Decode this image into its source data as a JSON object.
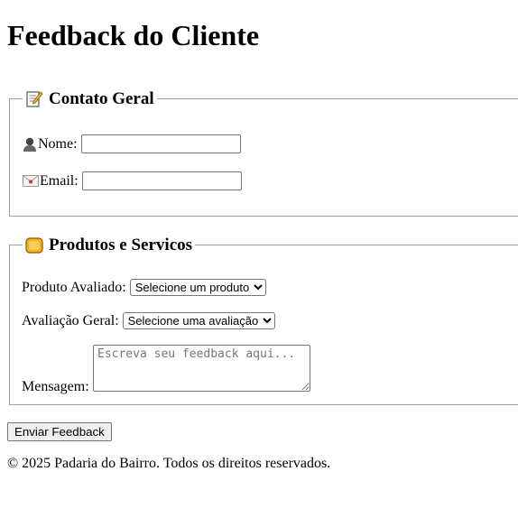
{
  "page": {
    "title": "Feedback do Cliente"
  },
  "contato": {
    "legend": "Contato Geral",
    "nome_label": "Nome:",
    "nome_value": "",
    "email_label": "Email:",
    "email_value": ""
  },
  "produtos": {
    "legend": "Produtos e Servicos",
    "produto_label": "Produto Avaliado:",
    "produto_selected": "Selecione um produto",
    "avaliacao_label": "Avaliação Geral:",
    "avaliacao_selected": "Selecione uma avaliação",
    "mensagem_label": "Mensagem:",
    "mensagem_placeholder": "Escreva seu feedback aqui..."
  },
  "actions": {
    "submit_label": "Enviar Feedback"
  },
  "footer": {
    "text": "© 2025 Padaria do Bairro. Todos os direitos reservados."
  },
  "icons": {
    "contato_legend_icon": "memo-icon",
    "produtos_legend_icon": "bread-icon",
    "nome_icon": "person-icon",
    "email_icon": "envelope-icon"
  }
}
